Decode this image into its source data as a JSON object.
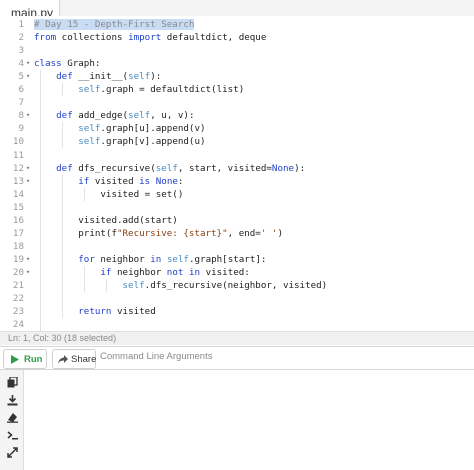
{
  "tab": {
    "label": "main.py"
  },
  "code_lines": [
    {
      "n": "1",
      "fold": "",
      "html": "<span class=\"cm\"><span class=\"sel\"># Day 15 - Depth-First Search</span></span>"
    },
    {
      "n": "2",
      "fold": "",
      "html": "<span class=\"kw\">from</span> collections <span class=\"kw\">import</span> defaultdict, deque"
    },
    {
      "n": "3",
      "fold": "",
      "html": ""
    },
    {
      "n": "4",
      "fold": "▾",
      "html": "<span class=\"kw\">class</span> Graph:"
    },
    {
      "n": "5",
      "fold": "▾",
      "html": "    <span class=\"kw\">def</span> __init__(<span class=\"self\">self</span>):"
    },
    {
      "n": "6",
      "fold": "",
      "html": "        <span class=\"self\">self</span>.graph = defaultdict(list)"
    },
    {
      "n": "7",
      "fold": "",
      "html": ""
    },
    {
      "n": "8",
      "fold": "▾",
      "html": "    <span class=\"kw\">def</span> add_edge(<span class=\"self\">self</span>, u, v):"
    },
    {
      "n": "9",
      "fold": "",
      "html": "        <span class=\"self\">self</span>.graph[u].append(v)"
    },
    {
      "n": "10",
      "fold": "",
      "html": "        <span class=\"self\">self</span>.graph[v].append(u)"
    },
    {
      "n": "11",
      "fold": "",
      "html": ""
    },
    {
      "n": "12",
      "fold": "▾",
      "html": "    <span class=\"kw\">def</span> dfs_recursive(<span class=\"self\">self</span>, start, visited=<span class=\"kw\">None</span>):"
    },
    {
      "n": "13",
      "fold": "▾",
      "html": "        <span class=\"kw\">if</span> visited <span class=\"kw\">is</span> <span class=\"kw\">None</span>:"
    },
    {
      "n": "14",
      "fold": "",
      "html": "            visited = set()"
    },
    {
      "n": "15",
      "fold": "",
      "html": ""
    },
    {
      "n": "16",
      "fold": "",
      "html": "        visited.add(start)"
    },
    {
      "n": "17",
      "fold": "",
      "html": "        print(f<span class=\"str\">\"Recursive: {start}\"</span>, end=<span class=\"str\">' '</span>)"
    },
    {
      "n": "18",
      "fold": "",
      "html": ""
    },
    {
      "n": "19",
      "fold": "▾",
      "html": "        <span class=\"kw\">for</span> neighbor <span class=\"kw\">in</span> <span class=\"self\">self</span>.graph[start]:"
    },
    {
      "n": "20",
      "fold": "▾",
      "html": "            <span class=\"kw\">if</span> neighbor <span class=\"kw\">not</span> <span class=\"kw\">in</span> visited:"
    },
    {
      "n": "21",
      "fold": "",
      "html": "                <span class=\"self\">self</span>.dfs_recursive(neighbor, visited)"
    },
    {
      "n": "22",
      "fold": "",
      "html": ""
    },
    {
      "n": "23",
      "fold": "",
      "html": "        <span class=\"kw\">return</span> visited"
    },
    {
      "n": "24",
      "fold": "",
      "html": ""
    }
  ],
  "status": {
    "text": "Ln: 1,  Col: 30 (18 selected)"
  },
  "toolbar": {
    "run_label": "Run",
    "share_label": "Share",
    "args_placeholder": "Command Line Arguments"
  },
  "colors": {
    "run_green": "#2e9e4d",
    "keyword": "#1f3fcc",
    "selection": "#c8dcf3"
  },
  "sidebar_icons": [
    "copy-icon",
    "download-icon",
    "clear-icon",
    "terminal-icon",
    "expand-icon"
  ]
}
